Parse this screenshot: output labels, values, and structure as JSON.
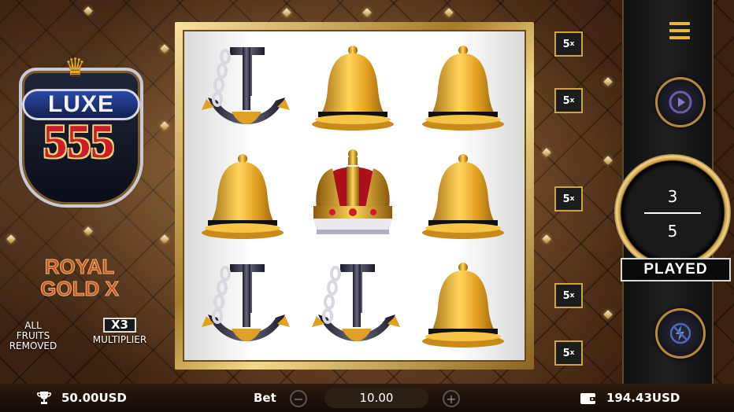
{
  "logo": {
    "word_top": "LUXE",
    "word_bottom": "555"
  },
  "feature": {
    "title_line1": "ROYAL",
    "title_line2": "GOLD X",
    "left_line1": "ALL",
    "left_line2": "FRUITS",
    "left_line3": "REMOVED",
    "multiplier_badge": "X3",
    "multiplier_label": "MULTIPLIER"
  },
  "reels": {
    "grid": [
      [
        "anchor",
        "bell",
        "bell"
      ],
      [
        "bell",
        "crown",
        "bell"
      ],
      [
        "anchor",
        "anchor",
        "bell"
      ]
    ]
  },
  "multipliers": [
    {
      "value": "5",
      "unit": "x"
    },
    {
      "value": "5",
      "unit": "x"
    },
    {
      "value": "5",
      "unit": "x"
    },
    {
      "value": "5",
      "unit": "x"
    },
    {
      "value": "5",
      "unit": "x"
    }
  ],
  "spin": {
    "played": "3",
    "total": "5",
    "label": "PLAYED"
  },
  "bottom": {
    "win_amount": "50.00USD",
    "bet_label": "Bet",
    "bet_value": "10.00",
    "minus": "−",
    "plus": "+",
    "balance": "194.43USD"
  },
  "colors": {
    "gold": "#e8b63a",
    "accent_red": "#d11a2a",
    "panel": "#111111"
  },
  "icons": [
    "trophy-icon",
    "wallet-icon",
    "menu-icon",
    "play-icon",
    "no-turbo-icon",
    "crown-icon"
  ]
}
